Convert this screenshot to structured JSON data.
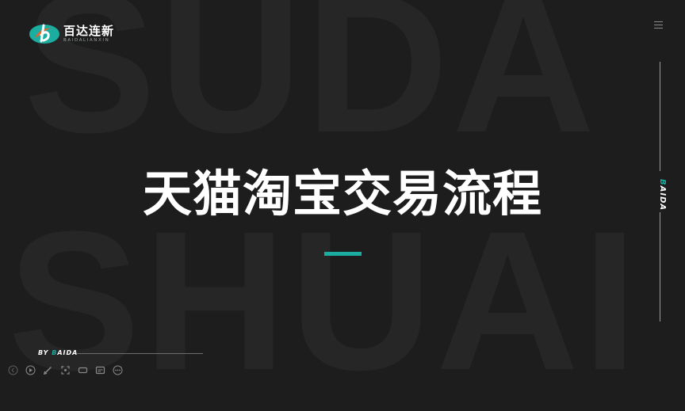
{
  "background": {
    "word_top": "SUDA",
    "word_bottom": "SHUAI"
  },
  "logo": {
    "name_cn": "百达连新",
    "name_en": "BAIDALIANXIN"
  },
  "side": {
    "label_accent": "B",
    "label_rest": "AIDA"
  },
  "main": {
    "title": "天猫淘宝交易流程"
  },
  "footer": {
    "by_prefix": "BY ",
    "by_accent": "B",
    "by_rest": "AIDA"
  },
  "toolbar": {
    "icons": [
      "prev-icon",
      "play-icon",
      "pen-icon",
      "zoom-icon",
      "video-icon",
      "subtitle-icon",
      "more-icon"
    ]
  },
  "colors": {
    "background": "#1d1d1e",
    "accent": "#1bada0",
    "logo_orange": "#e8622c",
    "text": "#ffffff"
  }
}
